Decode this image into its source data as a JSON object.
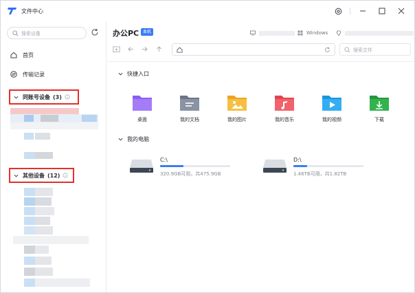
{
  "app": {
    "title": "文件中心"
  },
  "sidebar": {
    "search_placeholder": "搜索设备",
    "nav": [
      {
        "label": "首页",
        "icon": "home-icon"
      },
      {
        "label": "传输记录",
        "icon": "transfer-icon"
      }
    ],
    "groups": [
      {
        "label": "同账号设备",
        "count": "(3)"
      },
      {
        "label": "其他设备",
        "count": "(12)"
      }
    ]
  },
  "device": {
    "name": "办公PC",
    "badge": "本机",
    "os": "Windows"
  },
  "toolbar": {
    "file_search_placeholder": "搜索文件"
  },
  "quick_access": {
    "title": "快捷入口",
    "items": [
      {
        "label": "桌面",
        "icon": "desktop-folder-icon",
        "color": "#8b5cf6"
      },
      {
        "label": "我的文档",
        "icon": "documents-folder-icon",
        "color": "#7c8695"
      },
      {
        "label": "我的图片",
        "icon": "pictures-folder-icon",
        "color": "#f5b93a"
      },
      {
        "label": "我的音乐",
        "icon": "music-folder-icon",
        "color": "#f05a63"
      },
      {
        "label": "我的视频",
        "icon": "videos-folder-icon",
        "color": "#2ea7f0"
      },
      {
        "label": "下载",
        "icon": "downloads-folder-icon",
        "color": "#31b04a"
      }
    ]
  },
  "my_computer": {
    "title": "我的电脑",
    "drives": [
      {
        "name": "C:\\",
        "capacity": "320.9GB可用，共475.9GB",
        "used_fraction": 0.33
      },
      {
        "name": "D:\\",
        "capacity": "1.46TB可用，共1.82TB",
        "used_fraction": 0.2
      }
    ]
  },
  "colors": {
    "accent": "#3b7cf5",
    "highlight_border": "#e0312b"
  }
}
